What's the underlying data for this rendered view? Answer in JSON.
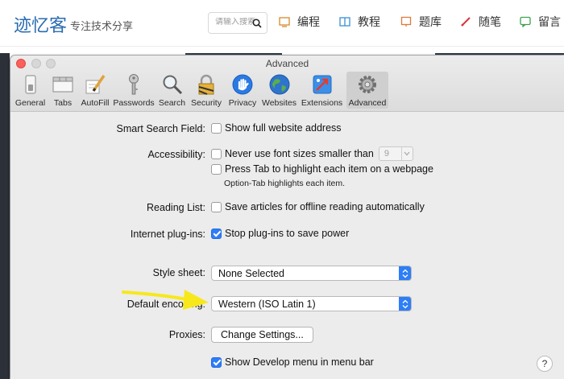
{
  "site": {
    "logo": "迹忆客",
    "tagline": "专注技术分享",
    "search_placeholder": "请输入搜索",
    "nav": [
      {
        "label": "编程",
        "icon": "code-icon"
      },
      {
        "label": "教程",
        "icon": "book-icon"
      },
      {
        "label": "题库",
        "icon": "question-bank-icon"
      },
      {
        "label": "随笔",
        "icon": "pencil-icon"
      },
      {
        "label": "留言",
        "icon": "message-icon"
      }
    ]
  },
  "window": {
    "title": "Advanced",
    "toolbar": [
      {
        "label": "General",
        "icon": "switch-icon"
      },
      {
        "label": "Tabs",
        "icon": "tabs-icon"
      },
      {
        "label": "AutoFill",
        "icon": "autofill-pencil-icon"
      },
      {
        "label": "Passwords",
        "icon": "key-icon"
      },
      {
        "label": "Search",
        "icon": "search-icon"
      },
      {
        "label": "Security",
        "icon": "lock-icon"
      },
      {
        "label": "Privacy",
        "icon": "hand-icon"
      },
      {
        "label": "Websites",
        "icon": "globe-icon"
      },
      {
        "label": "Extensions",
        "icon": "puzzle-icon"
      },
      {
        "label": "Advanced",
        "icon": "gear-icon",
        "active": true
      }
    ],
    "settings": {
      "smart_search": {
        "label": "Smart Search Field:",
        "option": "Show full website address",
        "checked": false
      },
      "accessibility": {
        "label": "Accessibility:",
        "option1": "Never use font sizes smaller than",
        "option1_checked": false,
        "font_size": "9",
        "option2": "Press Tab to highlight each item on a webpage",
        "option2_checked": false,
        "note": "Option-Tab highlights each item."
      },
      "reading_list": {
        "label": "Reading List:",
        "option": "Save articles for offline reading automatically",
        "checked": false
      },
      "plugins": {
        "label": "Internet plug-ins:",
        "option": "Stop plug-ins to save power",
        "checked": true
      },
      "style_sheet": {
        "label": "Style sheet:",
        "value": "None Selected"
      },
      "encoding": {
        "label": "Default encoding:",
        "value": "Western (ISO Latin 1)"
      },
      "proxies": {
        "label": "Proxies:",
        "button": "Change Settings..."
      },
      "develop": {
        "option": "Show Develop menu in menu bar",
        "checked": true
      }
    },
    "help": "?"
  },
  "colors": {
    "accent": "#2d7ef7",
    "arrow": "#f7e81c",
    "logo": "#2a6cb0"
  }
}
